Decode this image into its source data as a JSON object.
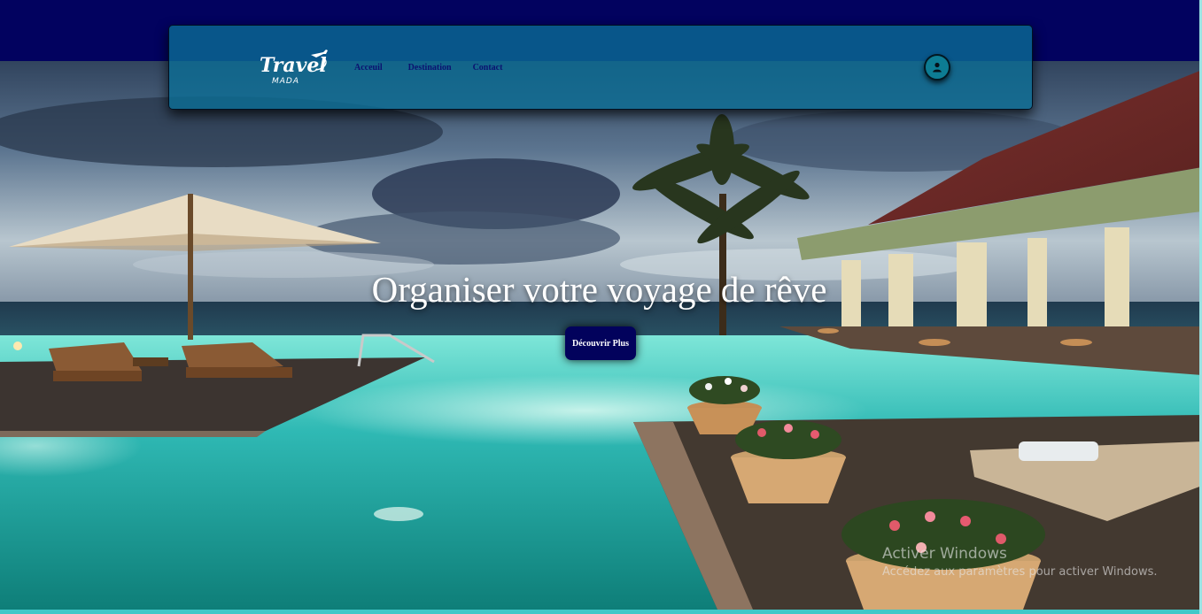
{
  "brand": {
    "logo_text": "Travel",
    "logo_subtext": "MADA"
  },
  "nav": {
    "links": [
      "Acceuil",
      "Destination",
      "Contact"
    ]
  },
  "hero": {
    "title": "Organiser votre voyage de rêve",
    "cta_label": "Découvrir Plus"
  },
  "watermark": {
    "title": "Activer Windows",
    "subtitle": "Accédez aux paramètres pour activer Windows."
  },
  "colors": {
    "top_band": "#02025f",
    "navbar": "#0a6e96",
    "nav_link": "#0b1270",
    "cta": "#02025c",
    "pool": "#30c0c0"
  },
  "icons": {
    "user": "user-icon",
    "plane": "plane-icon"
  }
}
